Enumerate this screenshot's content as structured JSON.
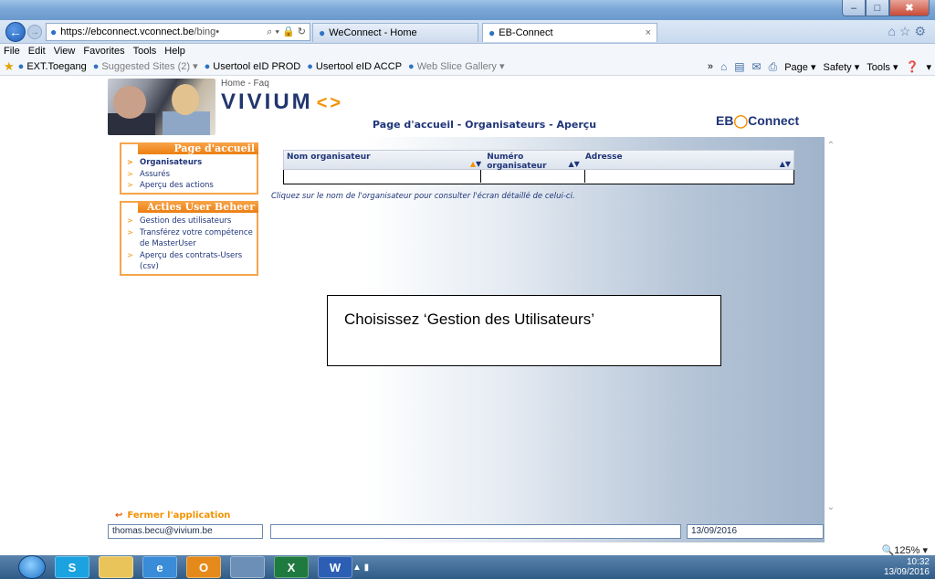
{
  "browser": {
    "url_domain": "https://ebconnect.vconnect.be",
    "url_rest": "/bing•",
    "url_icons": "⌕ ▾ 🔒 ↻",
    "tabs": [
      {
        "label": "WeConnect - Home"
      },
      {
        "label": "EB-Connect"
      }
    ],
    "tab_close": "×",
    "window_buttons": {
      "minimize": "–",
      "maximize": "□",
      "close": "✖"
    },
    "top_icons": "⌂☆⚙"
  },
  "menu": [
    "File",
    "Edit",
    "View",
    "Favorites",
    "Tools",
    "Help"
  ],
  "favorites": [
    {
      "label": "EXT.Toegang",
      "grey": false
    },
    {
      "label": "Suggested Sites (2) ▾",
      "grey": true
    },
    {
      "label": "Usertool eID PROD",
      "grey": false
    },
    {
      "label": "Usertool eID ACCP",
      "grey": false
    },
    {
      "label": "Web Slice Gallery ▾",
      "grey": true
    }
  ],
  "command_bar": {
    "overflow": "»",
    "page": "Page ▾",
    "safety": "Safety ▾",
    "tools": "Tools ▾",
    "help": "▾"
  },
  "site": {
    "top_nav": "Home - Faq",
    "brand": "VIVIUM",
    "brand_mark": "<>",
    "page_title": "Page d'accueil - Organisateurs - Aperçu",
    "partner_logo_left": "EB",
    "partner_logo_right": "Connect"
  },
  "left_nav": {
    "section1": {
      "title": "Page d'accueil",
      "items": [
        "Organisateurs",
        "Assurés",
        "Aperçu des actions"
      ]
    },
    "section2": {
      "title": "Acties User Beheer",
      "items": [
        "Gestion des utilisateurs",
        "Transférez votre compétence de MasterUser",
        "Aperçu des contrats-Users (csv)"
      ]
    }
  },
  "table": {
    "columns": [
      "Nom organisateur",
      "Numéro organisateur",
      "Adresse"
    ],
    "sort_up": "▲",
    "sort_down": "▼"
  },
  "hint": "Cliquez sur le nom de l'organisateur pour consulter l'écran détaillé de celui-ci.",
  "callout": "Choisissez ‘Gestion des Utilisateurs’",
  "footer": {
    "logout": "Fermer l'application",
    "email": "thomas.becu@vivium.be",
    "middle": "",
    "date": "13/09/2016"
  },
  "zoom": "125%",
  "taskbar": {
    "apps": [
      "S",
      "",
      "e",
      "O",
      "",
      "X",
      "W"
    ],
    "time": "10:32",
    "date": "13/09/2016"
  }
}
